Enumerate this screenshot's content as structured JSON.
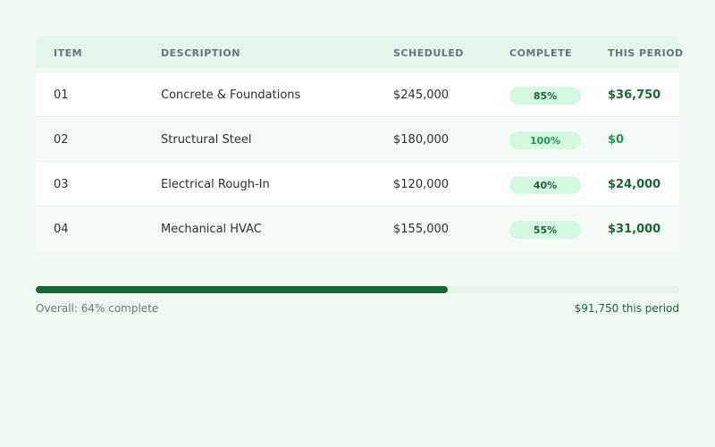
{
  "table": {
    "headers": {
      "item": "ITEM",
      "description": "DESCRIPTION",
      "scheduled": "SCHEDULED",
      "complete": "COMPLETE",
      "this_period": "THIS PERIOD"
    },
    "rows": [
      {
        "item": "01",
        "description": "Concrete & Foundations",
        "scheduled": "$245,000",
        "complete": "85%",
        "this_period": "$36,750"
      },
      {
        "item": "02",
        "description": "Structural Steel",
        "scheduled": "$180,000",
        "complete": "100%",
        "this_period": "$0"
      },
      {
        "item": "03",
        "description": "Electrical Rough-In",
        "scheduled": "$120,000",
        "complete": "40%",
        "this_period": "$24,000"
      },
      {
        "item": "04",
        "description": "Mechanical HVAC",
        "scheduled": "$155,000",
        "complete": "55%",
        "this_period": "$31,000"
      }
    ]
  },
  "summary": {
    "progress_percent": 64,
    "overall_label": "Overall: 64% complete",
    "period_label": "$91,750 this period"
  },
  "colors": {
    "accent": "#1a6634",
    "badge_bg": "#d5f8e0",
    "page_bg": "#f0f9f1"
  }
}
